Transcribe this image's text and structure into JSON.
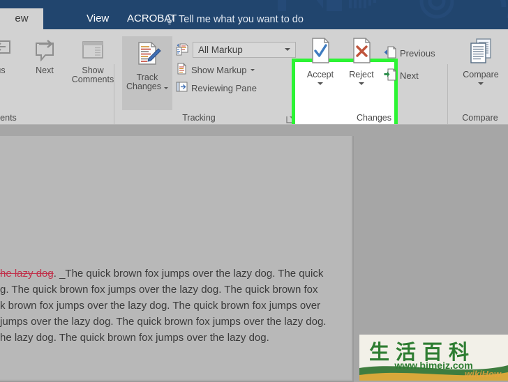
{
  "app": {
    "accent_blue": "#21456e",
    "ribbon_bg": "#d2d2d2",
    "highlight_color": "#2cf434"
  },
  "titlebar": {
    "tabs": [
      {
        "label": "ew",
        "active": true,
        "name": "tab-review"
      },
      {
        "label": "View",
        "active": false,
        "name": "tab-view"
      },
      {
        "label": "ACROBAT",
        "active": false,
        "name": "tab-acrobat"
      }
    ],
    "tell_me": "Tell me what you want to do",
    "tell_me_icon": "lightbulb-icon"
  },
  "ribbon": {
    "groups": [
      {
        "name": "comments",
        "title": "ents",
        "full_title": "Comments",
        "buttons": [
          {
            "label": "us",
            "full_label": "Previous",
            "icon": "previous-comment-icon"
          },
          {
            "label": "Next",
            "icon": "next-comment-icon"
          },
          {
            "label": "Show\nComments",
            "line1": "Show",
            "line2": "Comments",
            "icon": "show-comments-icon"
          }
        ]
      },
      {
        "name": "tracking",
        "title": "Tracking",
        "track_changes": {
          "line1": "Track",
          "line2": "Changes",
          "icon": "track-changes-icon",
          "selected": true,
          "has_dropdown": true
        },
        "markup_display": {
          "value": "All Markup",
          "icon": "markup-display-icon",
          "has_dropdown": true
        },
        "show_markup": {
          "label": "Show Markup",
          "icon": "show-markup-icon",
          "has_dropdown": true
        },
        "reviewing_pane": {
          "label": "Reviewing Pane",
          "icon": "reviewing-pane-icon",
          "has_dropdown": true
        },
        "dialog_launcher": "dialog-launcher-icon"
      },
      {
        "name": "changes",
        "title": "Changes",
        "highlighted": true,
        "accept": {
          "label": "Accept",
          "icon": "accept-change-icon",
          "has_dropdown": true
        },
        "reject": {
          "label": "Reject",
          "icon": "reject-change-icon",
          "has_dropdown": true
        },
        "previous": {
          "label": "Previous",
          "icon": "previous-change-icon"
        },
        "next": {
          "label": "Next",
          "icon": "next-change-icon"
        }
      },
      {
        "name": "compare",
        "title": "Compare",
        "compare": {
          "label": "Compare",
          "icon": "compare-documents-icon",
          "has_dropdown": true
        }
      }
    ]
  },
  "document": {
    "deleted_text": "he lazy dog",
    "lines": [
      ". _The quick brown fox jumps over the lazy dog. The quick",
      "g. The quick brown fox jumps over the lazy dog. The quick brown fox",
      "k brown fox jumps over the lazy dog. The quick brown fox jumps over",
      " jumps over the lazy dog. The quick brown fox jumps over the lazy dog.",
      "he lazy dog. The quick brown fox jumps over the lazy dog."
    ]
  },
  "watermark": {
    "chinese": "生活百科",
    "url": "www.bimeiz.com",
    "overlay": "wikiHow"
  }
}
